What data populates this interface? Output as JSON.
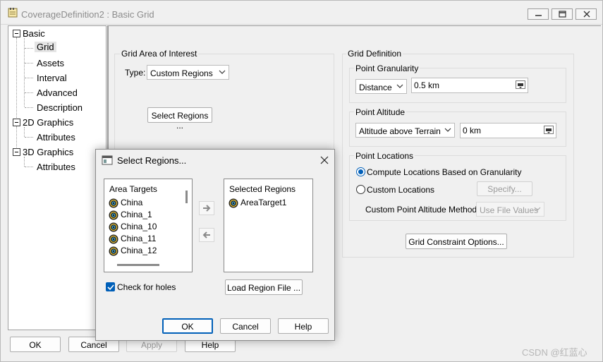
{
  "window": {
    "title": "CoverageDefinition2 : Basic Grid"
  },
  "tree": {
    "items": [
      {
        "label": "Basic"
      },
      {
        "label": "Grid"
      },
      {
        "label": "Assets"
      },
      {
        "label": "Interval"
      },
      {
        "label": "Advanced"
      },
      {
        "label": "Description"
      },
      {
        "label": "2D Graphics"
      },
      {
        "label": "Attributes"
      },
      {
        "label": "3D Graphics"
      },
      {
        "label": "Attributes"
      }
    ]
  },
  "grid_area": {
    "label": "Grid Area of Interest",
    "type_label": "Type:",
    "type_value": "Custom Regions",
    "select_regions": "Select Regions ..."
  },
  "grid_definition": {
    "label": "Grid Definition",
    "point_granularity": {
      "label": "Point Granularity",
      "mode": "Distance",
      "value": "0.5 km"
    },
    "point_altitude": {
      "label": "Point Altitude",
      "mode": "Altitude above Terrain",
      "value": "0 km"
    },
    "point_locations": {
      "label": "Point Locations",
      "compute_option": "Compute Locations Based on Granularity",
      "custom_option": "Custom Locations",
      "specify": "Specify...",
      "method_label": "Custom Point Altitude Method:",
      "method_value": "Use File Values"
    },
    "constraint_button": "Grid Constraint Options..."
  },
  "bottom_buttons": {
    "ok": "OK",
    "cancel": "Cancel",
    "apply": "Apply",
    "help": "Help"
  },
  "dialog": {
    "title": "Select Regions...",
    "area_targets": {
      "header": "Area Targets",
      "items": [
        "China",
        "China_1",
        "China_10",
        "China_11",
        "China_12"
      ]
    },
    "selected_regions": {
      "header": "Selected Regions",
      "items": [
        "AreaTarget1"
      ]
    },
    "check_for_holes": "Check for holes",
    "load_region_file": "Load Region File ...",
    "ok": "OK",
    "cancel": "Cancel",
    "help": "Help"
  },
  "watermark": "CSDN @红蓝心",
  "colors": {
    "accent": "#005fb8",
    "background": "#f0f0f0"
  }
}
